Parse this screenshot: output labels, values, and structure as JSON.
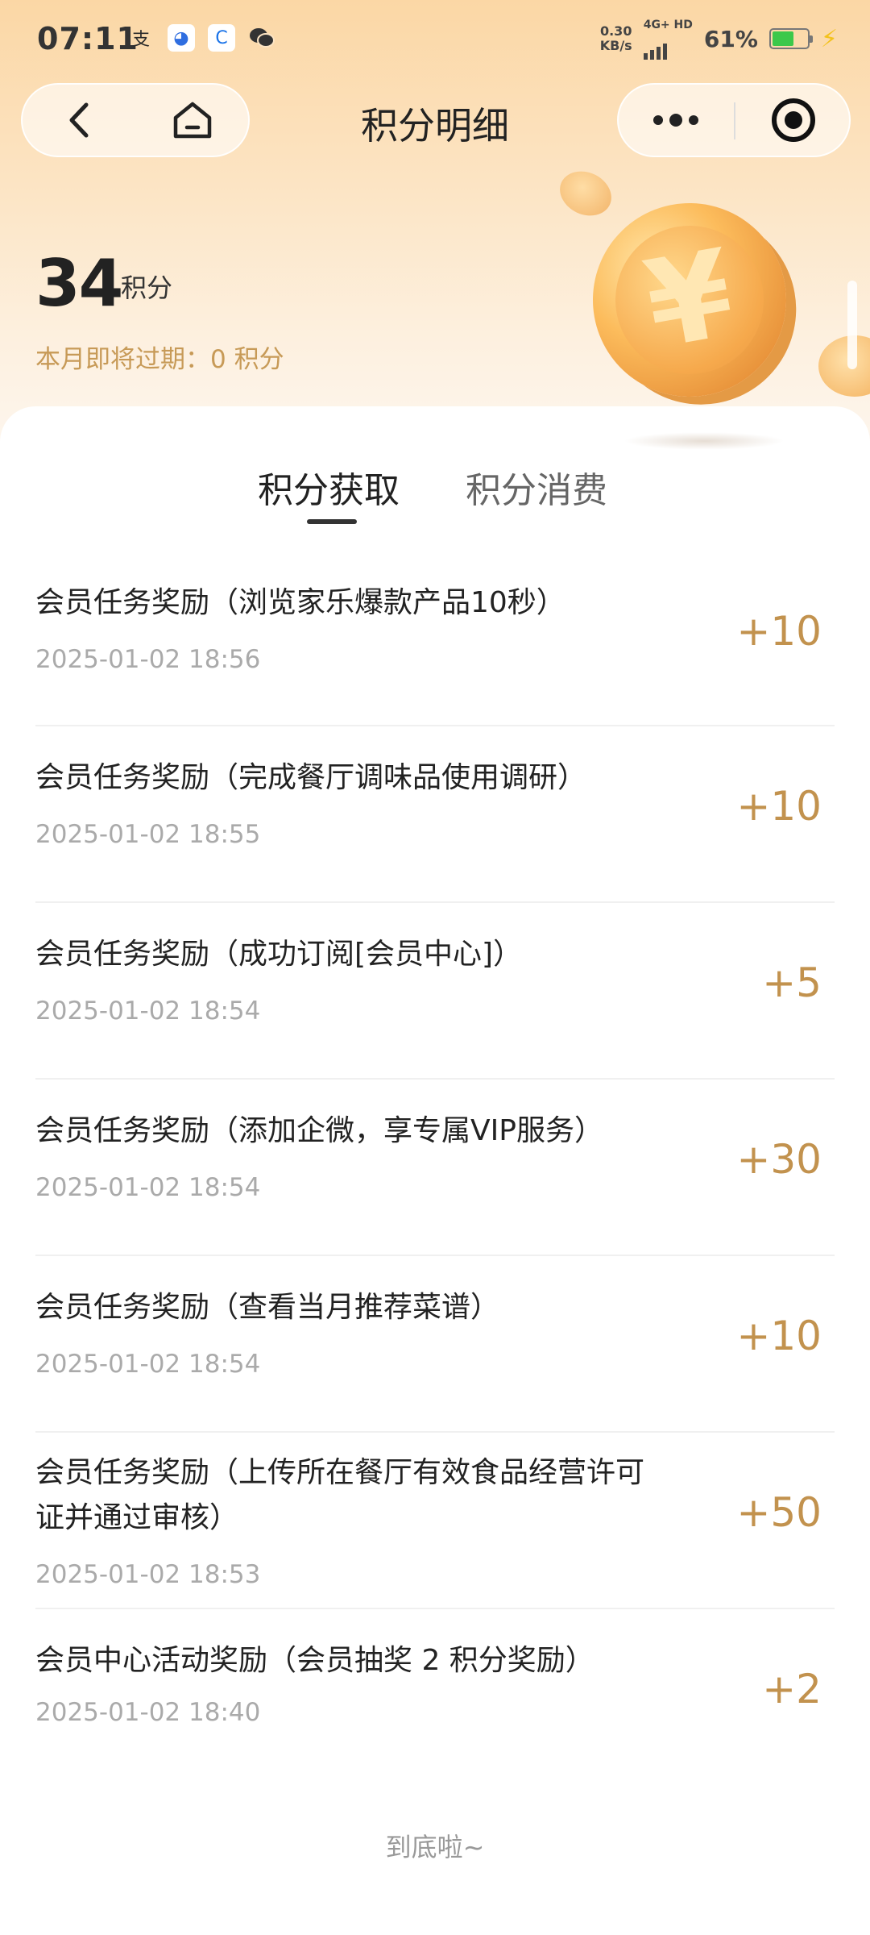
{
  "status_bar": {
    "time": "07:11",
    "net_speed": "0.30",
    "net_unit": "KB/s",
    "network": "4G+ HD",
    "battery": "61%",
    "battery_level": 0.61,
    "battery_color": "#3cc84a"
  },
  "nav": {
    "title": "积分明细",
    "back_icon": "back-chevron-icon",
    "home_icon": "home-icon",
    "more_icon": "more-dots-icon",
    "close_icon": "target-close-icon"
  },
  "summary": {
    "points": "34",
    "unit": "积分",
    "expire_text": "本月即将过期：0 积分"
  },
  "tabs": [
    {
      "label": "积分获取",
      "active": true
    },
    {
      "label": "积分消费",
      "active": false
    }
  ],
  "records": [
    {
      "title": "会员任务奖励（浏览家乐爆款产品10秒）",
      "date": "2025-01-02 18:56",
      "points": "+10"
    },
    {
      "title": "会员任务奖励（完成餐厅调味品使用调研）",
      "date": "2025-01-02 18:55",
      "points": "+10"
    },
    {
      "title": "会员任务奖励（成功订阅[会员中心]）",
      "date": "2025-01-02 18:54",
      "points": "+5"
    },
    {
      "title": "会员任务奖励（添加企微，享专属VIP服务）",
      "date": "2025-01-02 18:54",
      "points": "+30"
    },
    {
      "title": "会员任务奖励（查看当月推荐菜谱）",
      "date": "2025-01-02 18:54",
      "points": "+10"
    },
    {
      "title": "会员任务奖励（上传所在餐厅有效食品经营许可证并通过审核）",
      "date": "2025-01-02 18:53",
      "points": "+50"
    },
    {
      "title": "会员中心活动奖励（会员抽奖 2 积分奖励）",
      "date": "2025-01-02 18:40",
      "points": "+2"
    }
  ],
  "footer": {
    "end_text": "到底啦~"
  },
  "colors": {
    "accent": "#c2924e",
    "expire": "#c79a57"
  }
}
